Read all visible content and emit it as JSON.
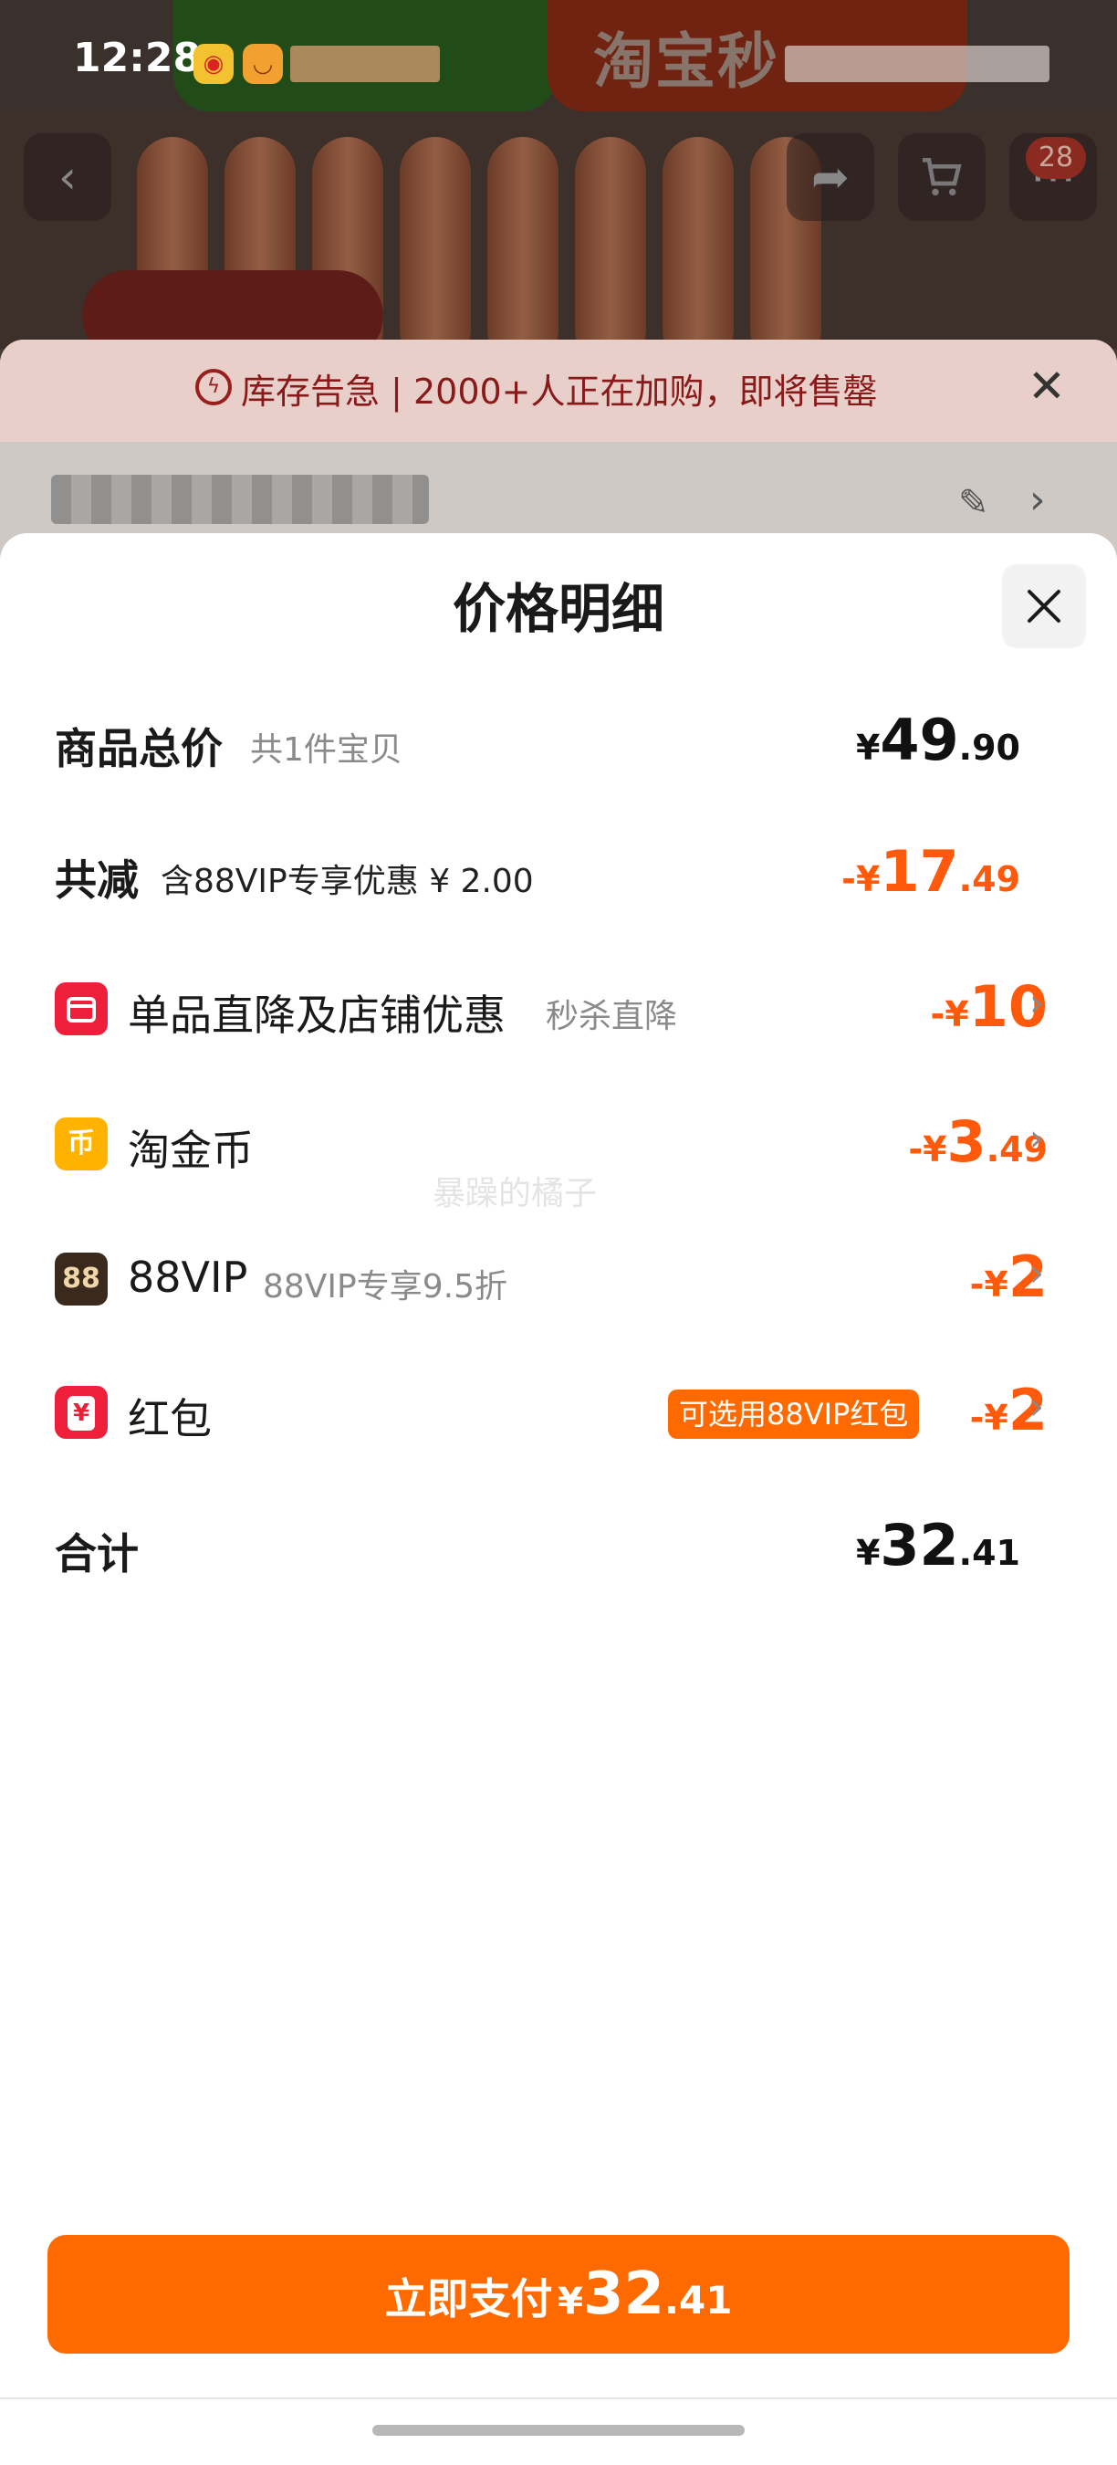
{
  "status_bar": {
    "time": "12:28"
  },
  "background": {
    "banner_text": "淘宝秒",
    "cart_badge": "28",
    "stock_alert": "库存告急 | 2000+人正在加购，即将售罄"
  },
  "sheet": {
    "title": "价格明细",
    "rows": [
      {
        "label": "商品总价",
        "sub": "共1件宝贝",
        "currency": "¥",
        "int": "49",
        "dec": ".90",
        "color": "#111111"
      },
      {
        "label": "共减",
        "sub": "含88VIP专享优惠 ¥ 2.00",
        "currency": "-¥",
        "int": "17",
        "dec": ".49",
        "color": "#ff5a0c"
      },
      {
        "label": "单品直降及店铺优惠",
        "sub": "秒杀直降",
        "icon": "shop-icon",
        "currency": "-¥",
        "int": "10",
        "dec": "",
        "color": "#ff5a0c"
      },
      {
        "label": "淘金币",
        "sub": "",
        "icon": "coin-icon",
        "currency": "-¥",
        "int": "3",
        "dec": ".49",
        "color": "#ff5a0c"
      },
      {
        "label": "88VIP",
        "sub": "88VIP专享9.5折",
        "icon": "vip-88-icon",
        "icon_text": "88",
        "currency": "-¥",
        "int": "2",
        "dec": "",
        "color": "#ff5a0c"
      },
      {
        "label": "红包",
        "sub": "",
        "tag": "可选用88VIP红包",
        "icon": "red-packet-icon",
        "icon_text": "¥",
        "currency": "-¥",
        "int": "2",
        "dec": "",
        "color": "#ff5a0c"
      }
    ],
    "total": {
      "label": "合计",
      "currency": "¥",
      "int": "32",
      "dec": ".41"
    },
    "watermark": "暴躁的橘子"
  },
  "pay_button": {
    "label": "立即支付",
    "currency": "¥",
    "int": "32",
    "dec": ".41"
  },
  "colors": {
    "accent": "#ff6a00",
    "discount": "#ff5a0c",
    "shop_icon": "#ee1f3b",
    "coin_icon": "#ffb300",
    "vip_icon": "#3a2a1e",
    "red_packet_icon": "#ee1f3b"
  }
}
